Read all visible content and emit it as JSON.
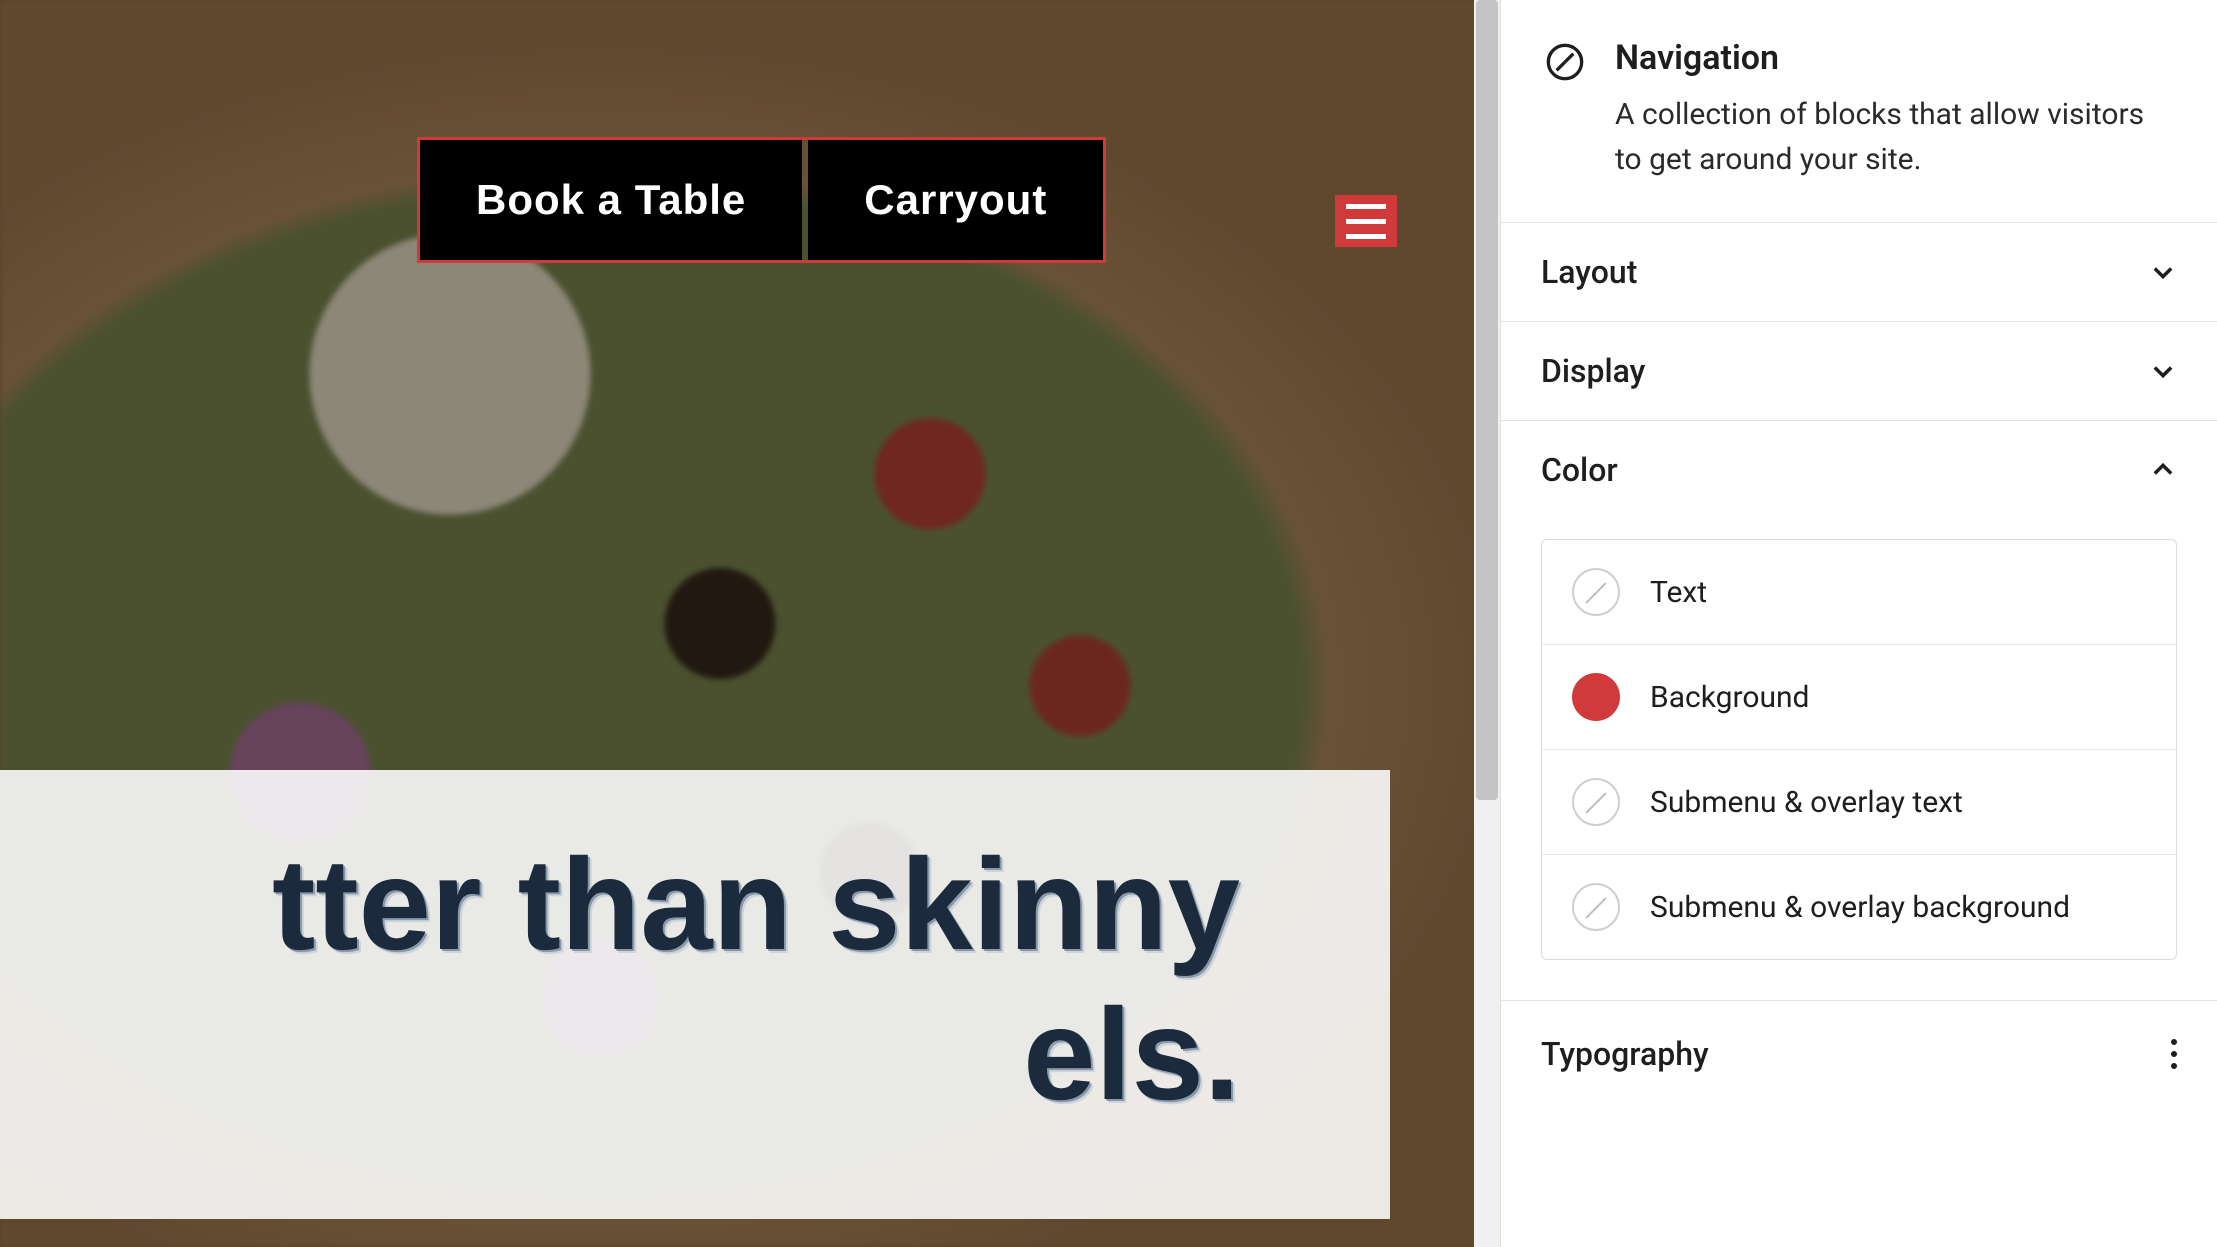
{
  "preview": {
    "nav_buttons": [
      {
        "label": "Book a Table"
      },
      {
        "label": "Carryout"
      }
    ],
    "hero_line1": "tter than skinny",
    "hero_line2": "els."
  },
  "sidebar": {
    "block": {
      "title": "Navigation",
      "description": "A collection of blocks that allow visitors to get around your site."
    },
    "panels": {
      "layout": {
        "label": "Layout",
        "expanded": false
      },
      "display": {
        "label": "Display",
        "expanded": false
      },
      "color": {
        "label": "Color",
        "expanded": true
      },
      "typography": {
        "label": "Typography"
      }
    },
    "colors": [
      {
        "name": "Text",
        "value": null
      },
      {
        "name": "Background",
        "value": "#d13a3a"
      },
      {
        "name": "Submenu & overlay text",
        "value": null
      },
      {
        "name": "Submenu & overlay background",
        "value": null
      }
    ]
  }
}
